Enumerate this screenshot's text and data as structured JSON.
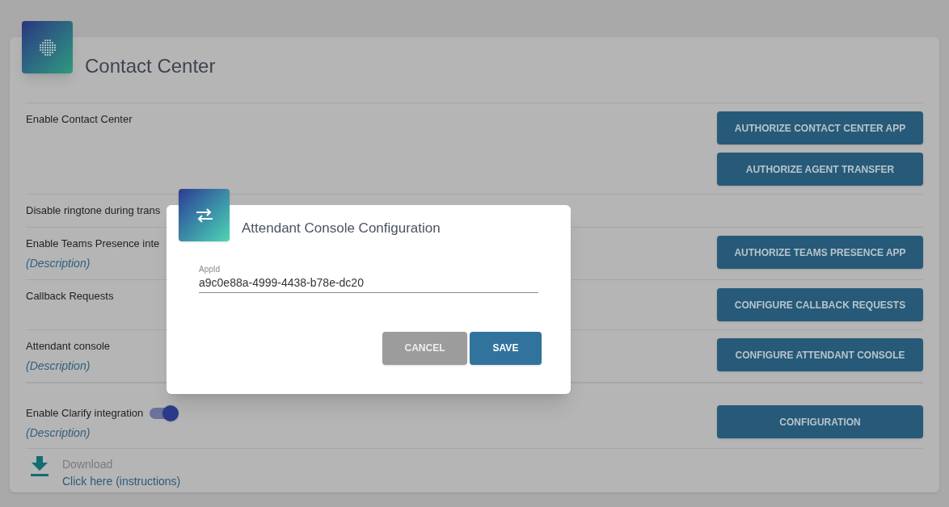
{
  "page": {
    "title": "Contact Center"
  },
  "rows": [
    {
      "label": "Enable Contact Center",
      "buttons": [
        "AUTHORIZE CONTACT CENTER APP",
        "AUTHORIZE AGENT TRANSFER"
      ]
    },
    {
      "label": "Disable ringtone during trans"
    },
    {
      "label": "Enable Teams Presence inte",
      "description": "(Description)",
      "buttons": [
        "AUTHORIZE TEAMS PRESENCE APP"
      ]
    },
    {
      "label": "Callback Requests",
      "buttons": [
        "CONFIGURE CALLBACK REQUESTS"
      ]
    },
    {
      "label": "Attendant console",
      "description": "(Description)",
      "buttons": [
        "CONFIGURE ATTENDANT CONSOLE"
      ]
    },
    {
      "label": "Enable Clarify integration",
      "description": "(Description)",
      "toggle": {
        "on": true
      },
      "buttons": [
        "CONFIGURATION"
      ]
    }
  ],
  "download": {
    "label": "Download",
    "link": "Click here (instructions)"
  },
  "dialog": {
    "title": "Attendant Console Configuration",
    "field": {
      "label": "AppId",
      "value": "a9c0e88a-4999-4438-b78e-dc20"
    },
    "buttons": [
      {
        "label": "CANCEL",
        "kind": "secondary"
      },
      {
        "label": "SAVE",
        "kind": "primary"
      }
    ]
  }
}
